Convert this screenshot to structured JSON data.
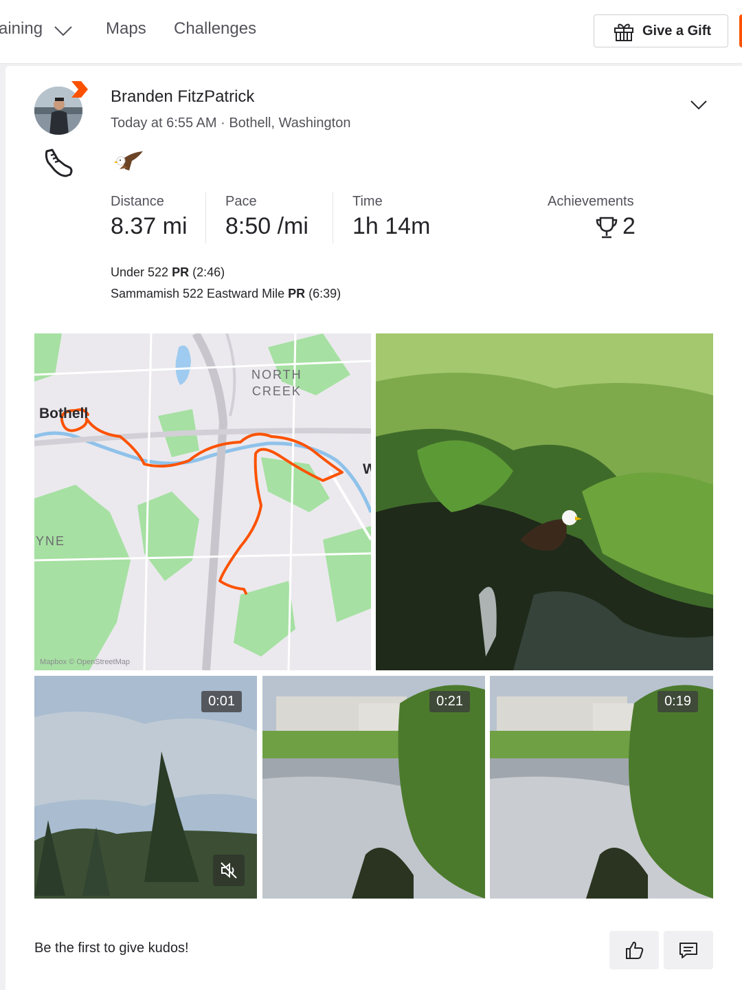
{
  "nav": {
    "training_label": "aining",
    "maps_label": "Maps",
    "challenges_label": "Challenges",
    "gift_label": "Give a Gift"
  },
  "activity": {
    "athlete_name": "Branden FitzPatrick",
    "meta": "Today at 6:55 AM · Bothell, Washington",
    "stats": {
      "distance_label": "Distance",
      "distance_value": "8.37 mi",
      "pace_label": "Pace",
      "pace_value": "8:50 /mi",
      "time_label": "Time",
      "time_value": "1h 14m",
      "achievements_label": "Achievements",
      "achievements_value": "2"
    },
    "segments": [
      {
        "name": "Under 522",
        "pr": "PR",
        "time": "(2:46)"
      },
      {
        "name": "Sammamish 522 Eastward Mile",
        "pr": "PR",
        "time": "(6:39)"
      }
    ],
    "map": {
      "label_north_creek_1": "NORTH",
      "label_north_creek_2": "CREEK",
      "label_town": "Bothell",
      "label_yne": "YNE",
      "label_w": "W",
      "attribution": "Mapbox © OpenStreetMap"
    },
    "videos": [
      {
        "duration": "0:01"
      },
      {
        "duration": "0:21"
      },
      {
        "duration": "0:19"
      }
    ],
    "kudos_prompt": "Be the first to give kudos!"
  },
  "colors": {
    "brand": "#fc5200",
    "route": "#fc5200"
  },
  "icons": {
    "gift": "gift-icon",
    "chevron": "chevron-down-icon",
    "shoe": "run-shoe-icon",
    "trophy": "trophy-icon",
    "mute": "mute-icon",
    "thumbs_up": "thumbs-up-icon",
    "comment": "comment-icon"
  }
}
